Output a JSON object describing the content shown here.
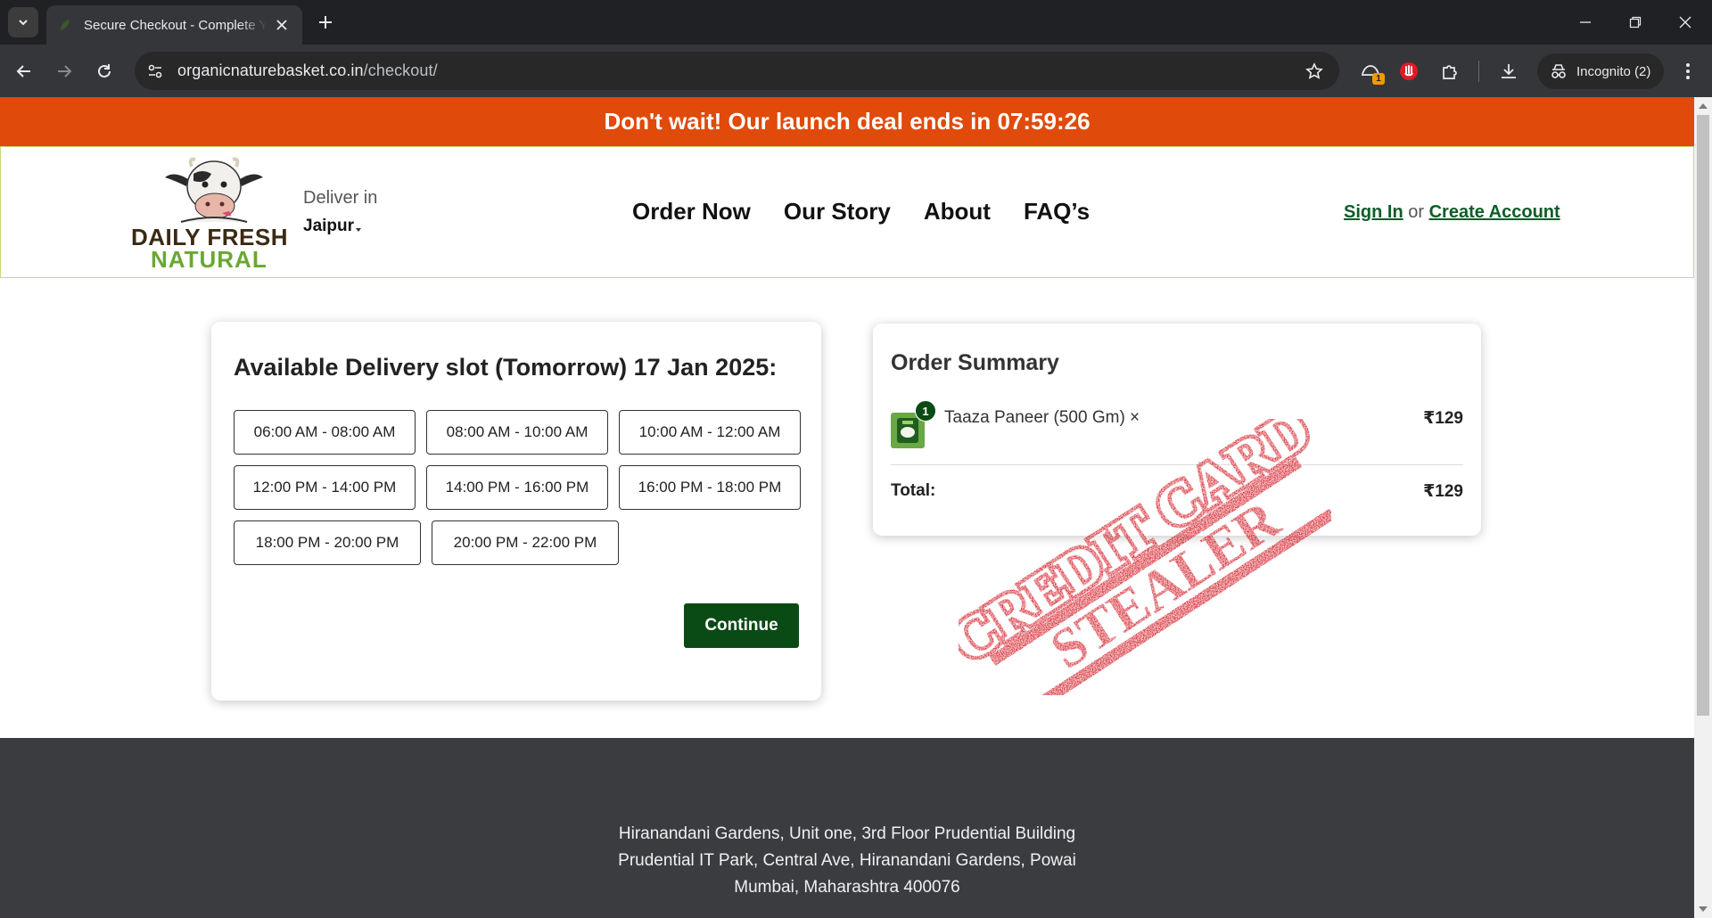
{
  "browser": {
    "tab_title": "Secure Checkout - Complete Your Order",
    "url_domain": "organicnaturebasket.co.in",
    "url_path": "/checkout/",
    "incognito_label": "Incognito (2)",
    "extension_badge": "1"
  },
  "promo": {
    "text": "Don't wait! Our launch deal ends in 07:59:26"
  },
  "header": {
    "logo_line1": "DAILY FRESH",
    "logo_line2": "NATURAL",
    "deliver_label": "Deliver in",
    "deliver_city": "Jaipur",
    "nav": [
      {
        "label": "Order Now"
      },
      {
        "label": "Our Story"
      },
      {
        "label": "About"
      },
      {
        "label": "FAQ’s"
      }
    ],
    "sign_in": "Sign In",
    "or": "or",
    "create_account": "Create Account"
  },
  "delivery": {
    "title": "Available Delivery slot (Tomorrow) 17 Jan 2025:",
    "slots": [
      "06:00 AM - 08:00 AM",
      "08:00 AM - 10:00 AM",
      "10:00 AM - 12:00 AM",
      "12:00 PM - 14:00 PM",
      "14:00 PM - 16:00 PM",
      "16:00 PM - 18:00 PM",
      "18:00 PM - 20:00 PM",
      "20:00 PM - 22:00 PM"
    ],
    "continue_label": "Continue"
  },
  "summary": {
    "title": "Order Summary",
    "item": {
      "qty": "1",
      "name": "Taaza Paneer (500 Gm) ×",
      "price": "₹129"
    },
    "total_label": "Total:",
    "total_value": "₹129"
  },
  "stamp": {
    "line1": "CREDIT CARD",
    "line2": "STEALER",
    "color": "#d2121d"
  },
  "footer": {
    "address_lines": [
      "Hiranandani Gardens, Unit one, 3rd Floor Prudential Building",
      "Prudential IT Park, Central Ave, Hiranandani Gardens, Powai",
      "Mumbai, Maharashtra 400076"
    ]
  },
  "colors": {
    "promo_bg": "#e04a0a",
    "brand_green": "#0a4a14",
    "footer_bg": "#3b3c40"
  }
}
